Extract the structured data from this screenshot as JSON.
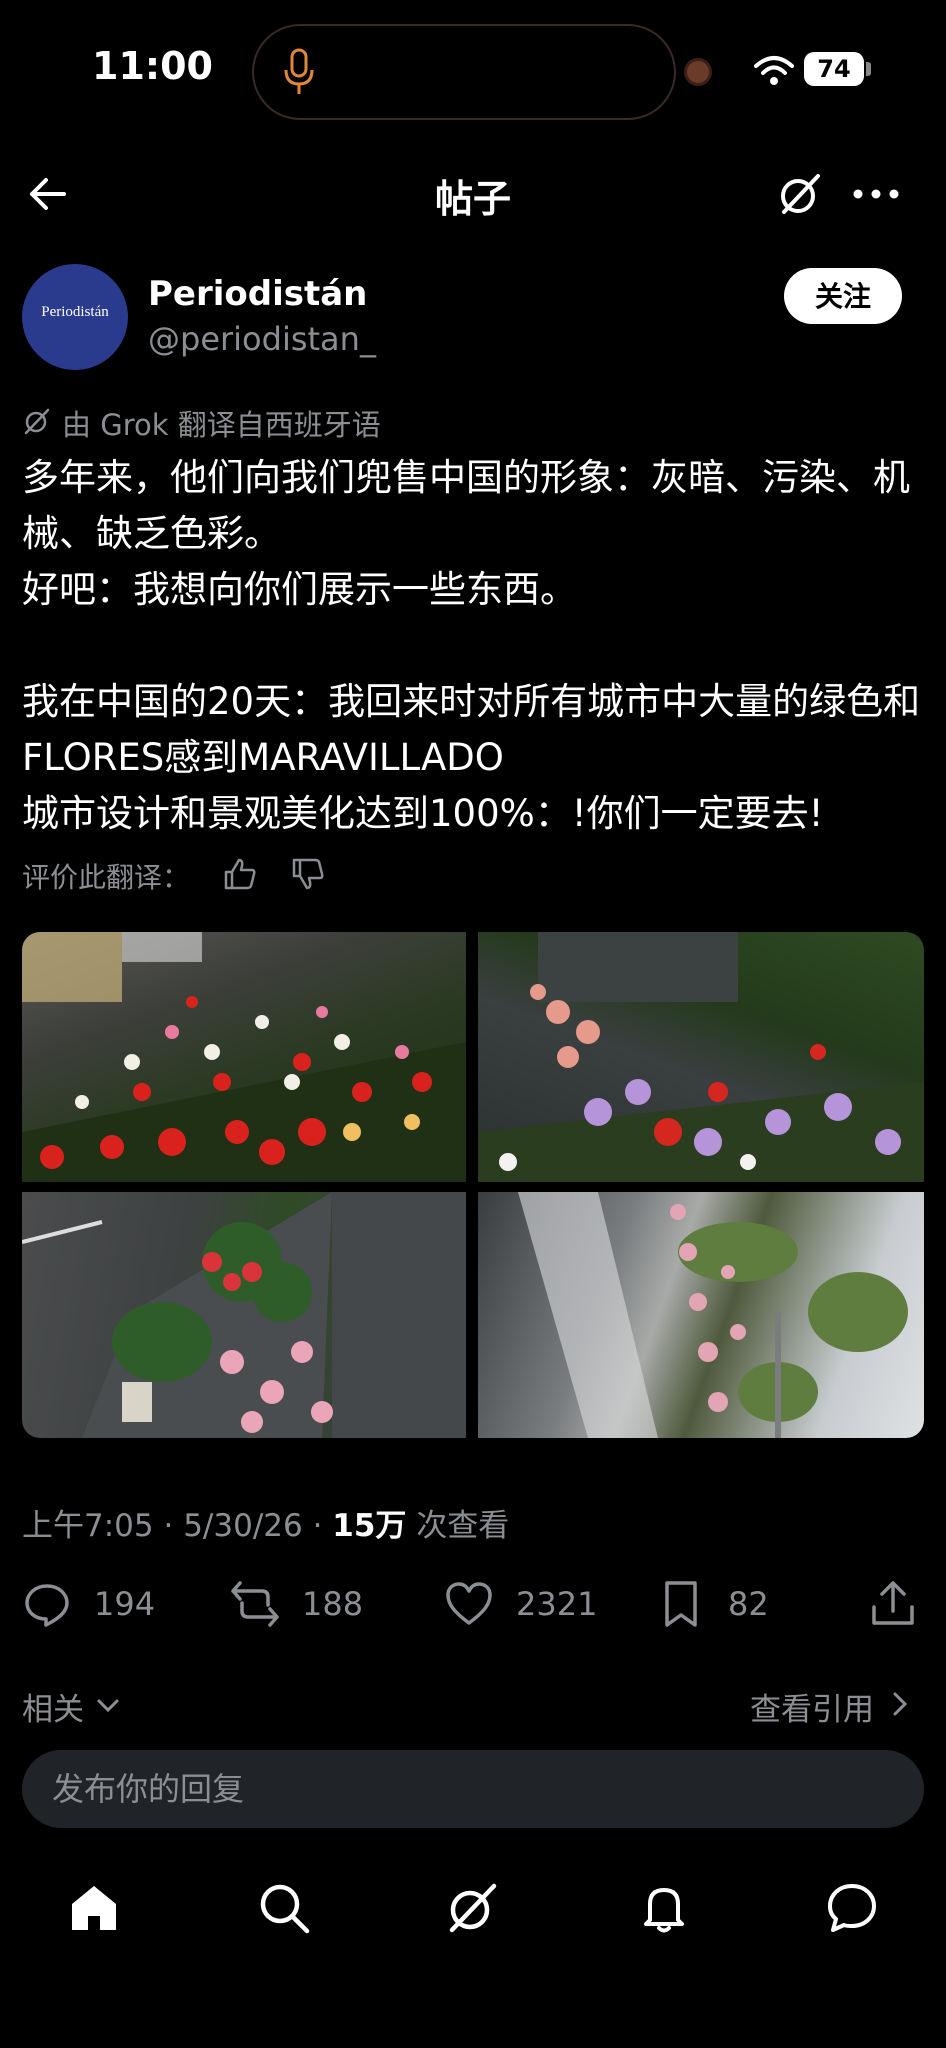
{
  "status_bar": {
    "time": "11:00",
    "battery": "74"
  },
  "header": {
    "title": "帖子"
  },
  "author": {
    "display_name": "Periodistán",
    "handle": "@periodistan_",
    "avatar_text": "Periodistán",
    "follow_label": "关注"
  },
  "translation_note": "由 Grok 翻译自西班牙语",
  "tweet": {
    "paragraphs": [
      "多年来，他们向我们兜售中国的形象：灰暗、污染、机械、缺乏色彩。\n好吧：我想向你们展示一些东西。",
      "我在中国的20天：我回来时对所有城市中大量的绿色和FLORES感到MARAVILLADO\n城市设计和景观美化达到100%：!你们一定要去!"
    ]
  },
  "rate_translation": "评价此翻译：",
  "meta": {
    "time": "上午7:05",
    "sep": "·",
    "date": "5/30/26",
    "views": "15万",
    "views_label": "次查看"
  },
  "actions": {
    "replies": "194",
    "reposts": "188",
    "likes": "2321",
    "bookmarks": "82"
  },
  "related_label": "相关",
  "view_quotes_label": "查看引用",
  "reply_placeholder": "发布你的回复",
  "nav": [
    "home-icon",
    "search-icon",
    "grok-icon",
    "notifications-icon",
    "messages-icon"
  ],
  "colors": {
    "background": "#000000",
    "muted": "#8b8f94",
    "text": "#e7e9ea",
    "reply_box": "#202327"
  }
}
